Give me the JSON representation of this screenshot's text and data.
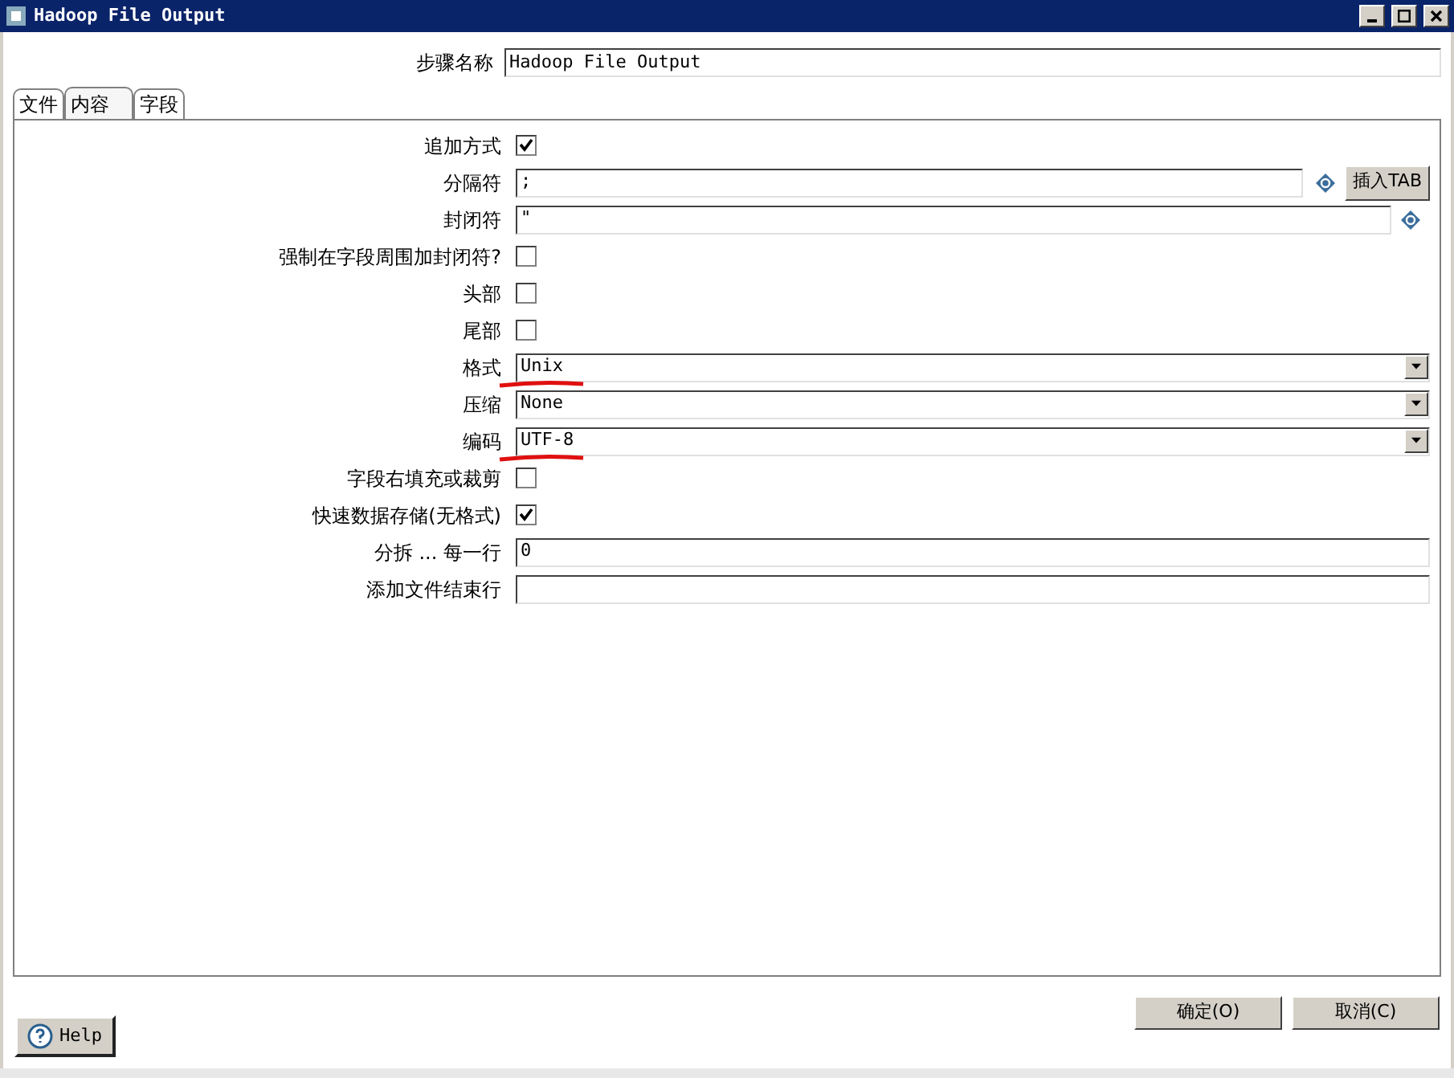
{
  "window": {
    "title": "Hadoop File Output"
  },
  "step_name": {
    "label": "步骤名称",
    "value": "Hadoop File Output"
  },
  "tabs": [
    {
      "label": "文件",
      "selected": false
    },
    {
      "label": "内容",
      "selected": true
    },
    {
      "label": "字段",
      "selected": false
    }
  ],
  "rows": [
    {
      "kind": "checkbox",
      "label": "追加方式",
      "checked": true,
      "underlined": false
    },
    {
      "kind": "text",
      "label": "分隔符",
      "value": ";",
      "variable": true,
      "button": "插入TAB",
      "underlined": false
    },
    {
      "kind": "text",
      "label": "封闭符",
      "value": "\"",
      "variable": true,
      "underlined": false
    },
    {
      "kind": "checkbox",
      "label": "强制在字段周围加封闭符?",
      "checked": false,
      "underlined": false
    },
    {
      "kind": "checkbox",
      "label": "头部",
      "checked": false,
      "underlined": false
    },
    {
      "kind": "checkbox",
      "label": "尾部",
      "checked": false,
      "underlined": false
    },
    {
      "kind": "dropdown",
      "label": "格式",
      "value": "Unix",
      "underlined": true
    },
    {
      "kind": "dropdown",
      "label": "压缩",
      "value": "None",
      "underlined": false
    },
    {
      "kind": "dropdown",
      "label": "编码",
      "value": "UTF-8",
      "underlined": true
    },
    {
      "kind": "checkbox",
      "label": "字段右填充或裁剪",
      "checked": false,
      "underlined": false
    },
    {
      "kind": "checkbox",
      "label": "快速数据存储(无格式)",
      "checked": true,
      "underlined": false
    },
    {
      "kind": "text",
      "label": "分拆 ... 每一行",
      "value": "0",
      "variable": false,
      "underlined": false
    },
    {
      "kind": "text",
      "label": "添加文件结束行",
      "value": "",
      "variable": false,
      "underlined": false
    }
  ],
  "help_button": "Help",
  "buttons": [
    "确定(O)",
    "取消(C)"
  ]
}
